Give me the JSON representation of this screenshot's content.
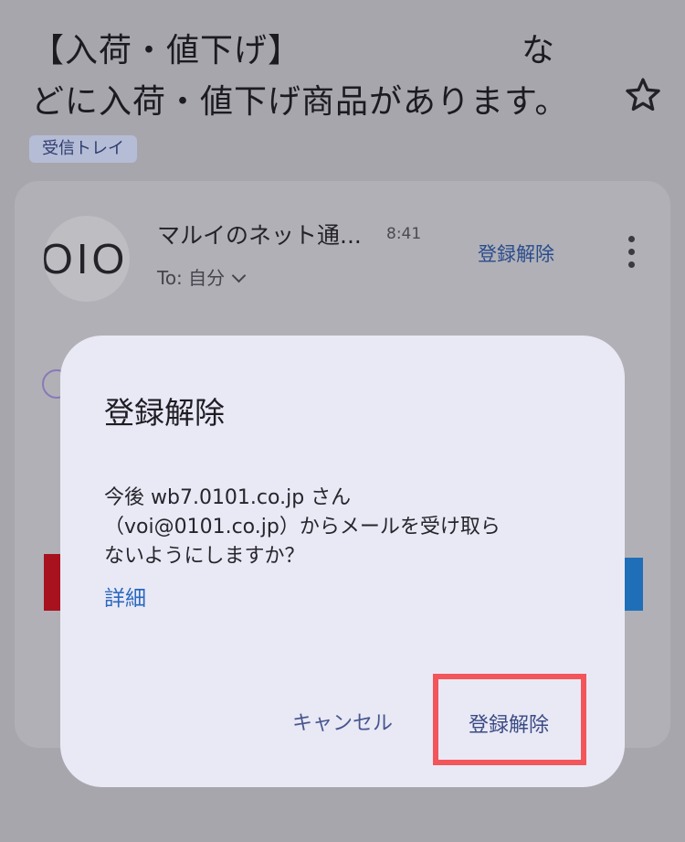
{
  "email": {
    "subject_line1": "【入荷・値下げ】　　　　　　　な",
    "subject_line2": "どに入荷・値下げ商品があります。",
    "label": "受信トレイ",
    "avatar_text": "OIO",
    "sender": "マルイのネット通...",
    "time": "8:41",
    "unsubscribe_link": "登録解除",
    "to": "To: 自分"
  },
  "dialog": {
    "title": "登録解除",
    "body_line1": "今後 wb7.0101.co.jp さん",
    "body_line2": "（voi@0101.co.jp）からメールを受け取ら",
    "body_line3": "ないようにしますか？",
    "details": "詳細",
    "cancel": "キャンセル",
    "confirm": "登録解除"
  },
  "colors": {
    "scrim_background": "#a8a6ad",
    "dialog_background": "#e9e9f5",
    "link_blue": "#2a68c0",
    "highlight": "#f2565a"
  }
}
